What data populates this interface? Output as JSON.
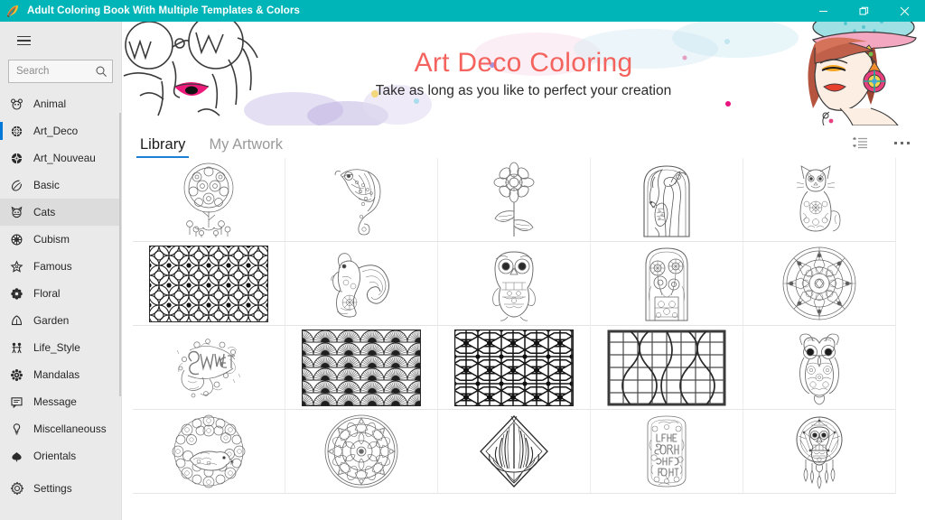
{
  "window": {
    "title": "Adult Coloring Book With Multiple Templates & Colors",
    "titlebar_color": "#00b5b8",
    "app_icon": "leaf-palette-icon",
    "controls": {
      "minimize": "minimize-icon",
      "restore": "restore-icon",
      "close": "close-icon"
    }
  },
  "sidebar": {
    "menu_icon": "hamburger-icon",
    "search": {
      "placeholder": "Search",
      "value": "",
      "icon": "search-icon"
    },
    "selected": "Art_Deco",
    "hovered": "Cats",
    "items": [
      {
        "label": "Animal",
        "icon": "animal-icon"
      },
      {
        "label": "Art_Deco",
        "icon": "art-deco-icon"
      },
      {
        "label": "Art_Nouveau",
        "icon": "art-nouveau-icon"
      },
      {
        "label": "Basic",
        "icon": "basic-icon"
      },
      {
        "label": "Cats",
        "icon": "cat-icon"
      },
      {
        "label": "Cubism",
        "icon": "cubism-icon"
      },
      {
        "label": "Famous",
        "icon": "star-icon"
      },
      {
        "label": "Floral",
        "icon": "floral-icon"
      },
      {
        "label": "Garden",
        "icon": "garden-icon"
      },
      {
        "label": "Life_Style",
        "icon": "life-style-icon"
      },
      {
        "label": "Mandalas",
        "icon": "mandala-icon"
      },
      {
        "label": "Message",
        "icon": "message-icon"
      },
      {
        "label": "Miscellaneouss",
        "icon": "miscellaneous-icon"
      },
      {
        "label": "Orientals",
        "icon": "orientals-icon"
      }
    ],
    "settings": {
      "label": "Settings",
      "icon": "gear-icon"
    }
  },
  "banner": {
    "title": "Art Deco Coloring",
    "subtitle": "Take as long as you like to perfect your creation",
    "title_color": "#f4635e",
    "left_art": "woman-with-glasses-lineart",
    "right_art": "woman-with-hat-colored-illustration"
  },
  "tabs": {
    "items": [
      {
        "label": "Library",
        "active": true
      },
      {
        "label": "My Artwork",
        "active": false
      }
    ],
    "actions": [
      {
        "name": "sort-list-icon"
      },
      {
        "name": "more-options-icon"
      }
    ],
    "accent_color": "#1e7fd4"
  },
  "gallery": {
    "items": [
      {
        "name": "ornate-tree",
        "shape": "tall"
      },
      {
        "name": "chameleon",
        "shape": "tall"
      },
      {
        "name": "flower-stem",
        "shape": "tall"
      },
      {
        "name": "woman-with-peacock",
        "shape": "tall"
      },
      {
        "name": "ornate-cat",
        "shape": "tall"
      },
      {
        "name": "geometric-circle-pattern",
        "shape": "wide"
      },
      {
        "name": "squirrel",
        "shape": "sq"
      },
      {
        "name": "owl-standing",
        "shape": "tall"
      },
      {
        "name": "floral-panel",
        "shape": "tall"
      },
      {
        "name": "round-mandala-rosette",
        "shape": "sq"
      },
      {
        "name": "sweet-lettering",
        "shape": "sq"
      },
      {
        "name": "art-deco-fan-pattern",
        "shape": "wide"
      },
      {
        "name": "geometric-star-pattern",
        "shape": "wide"
      },
      {
        "name": "lattice-window-pattern",
        "shape": "wide"
      },
      {
        "name": "owl-ornate",
        "shape": "tall"
      },
      {
        "name": "hedgehog-in-flowers",
        "shape": "sq"
      },
      {
        "name": "circular-mandala",
        "shape": "sq"
      },
      {
        "name": "art-deco-diamond-fan",
        "shape": "sq"
      },
      {
        "name": "life-is-short-lettering",
        "shape": "tall"
      },
      {
        "name": "owl-dreamcatcher",
        "shape": "tall"
      }
    ]
  }
}
